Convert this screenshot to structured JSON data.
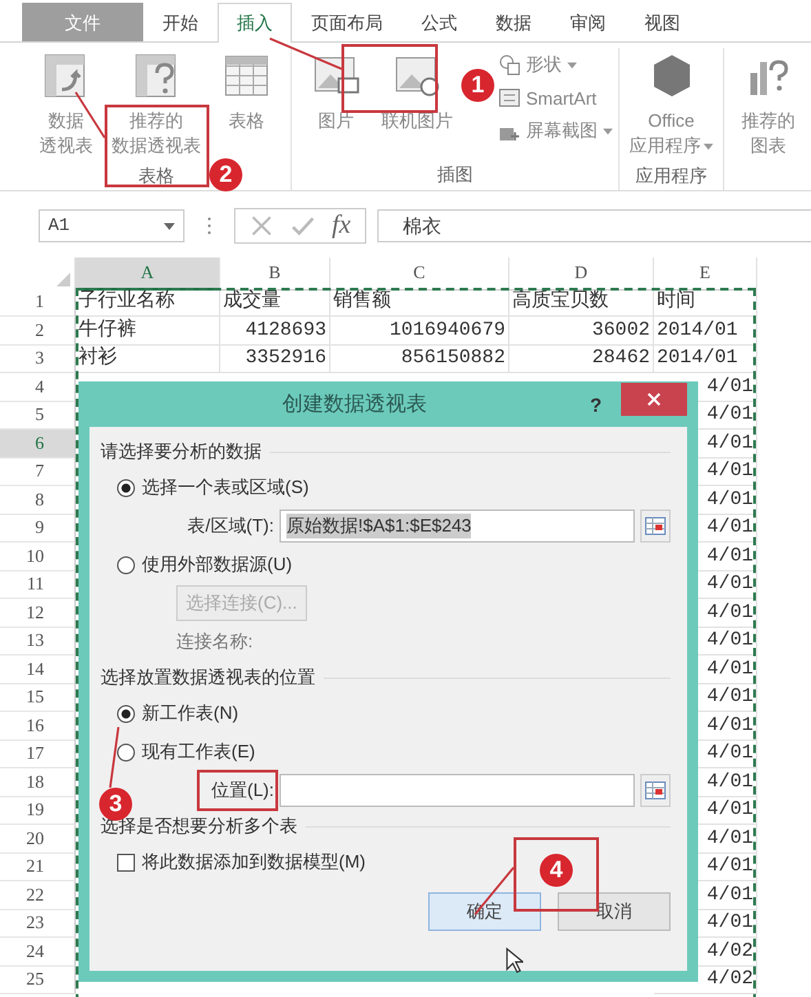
{
  "ribbon": {
    "tabs": [
      {
        "label": "文件",
        "kind": "file",
        "selected": false
      },
      {
        "label": "开始",
        "kind": "tab",
        "selected": false
      },
      {
        "label": "插入",
        "kind": "tab",
        "selected": true
      },
      {
        "label": "页面布局",
        "kind": "tab",
        "selected": false
      },
      {
        "label": "公式",
        "kind": "tab",
        "selected": false
      },
      {
        "label": "数据",
        "kind": "tab",
        "selected": false
      },
      {
        "label": "审阅",
        "kind": "tab",
        "selected": false
      },
      {
        "label": "视图",
        "kind": "tab",
        "selected": false
      }
    ],
    "groups": [
      {
        "label": "表格",
        "items": [
          {
            "kind": "large",
            "lines": [
              "数据",
              "透视表"
            ]
          },
          {
            "kind": "large",
            "lines": [
              "推荐的",
              "数据透视表"
            ]
          },
          {
            "kind": "large",
            "lines": [
              "表格"
            ]
          }
        ]
      },
      {
        "label": "插图",
        "items": [
          {
            "kind": "large",
            "lines": [
              "图片"
            ]
          },
          {
            "kind": "large",
            "lines": [
              "联机图片"
            ]
          },
          {
            "kind": "small",
            "lines": [
              "形状"
            ],
            "dropdown": true
          },
          {
            "kind": "small",
            "lines": [
              "SmartArt"
            ],
            "dropdown": false
          },
          {
            "kind": "small",
            "lines": [
              "屏幕截图"
            ],
            "dropdown": true
          }
        ]
      },
      {
        "label": "应用程序",
        "items": [
          {
            "kind": "large",
            "lines": [
              "Office",
              "应用程序"
            ],
            "dropdown": true
          }
        ]
      },
      {
        "items": [
          {
            "kind": "large",
            "lines": [
              "推荐的",
              "图表"
            ]
          }
        ]
      }
    ]
  },
  "formula_bar": {
    "name_box": "A1",
    "function_label": "fx",
    "formula": "棉衣"
  },
  "sheet": {
    "columns": [
      {
        "label": "A",
        "selected": true
      },
      {
        "label": "B",
        "selected": false
      },
      {
        "label": "C",
        "selected": false
      },
      {
        "label": "D",
        "selected": false
      },
      {
        "label": "E",
        "selected": false
      }
    ],
    "rows": [
      {
        "number": "1",
        "selected": false,
        "cells": [
          "子行业名称",
          "成交量",
          "销售额",
          "高质宝贝数",
          "时间"
        ]
      },
      {
        "number": "2",
        "selected": false,
        "cells": [
          "牛仔裤",
          "4128693",
          "1016940679",
          "36002",
          "2014/01"
        ]
      },
      {
        "number": "3",
        "selected": false,
        "cells": [
          "衬衫",
          "3352916",
          "856150882",
          "28462",
          "2014/01"
        ]
      },
      {
        "number": "4",
        "selected": false,
        "cells": [
          "4/01"
        ]
      },
      {
        "number": "5",
        "selected": false,
        "cells": [
          "4/01"
        ]
      },
      {
        "number": "6",
        "selected": true,
        "cells": [
          "4/01"
        ]
      },
      {
        "number": "7",
        "selected": false,
        "cells": [
          "4/01"
        ]
      },
      {
        "number": "8",
        "selected": false,
        "cells": [
          "4/01"
        ]
      },
      {
        "number": "9",
        "selected": false,
        "cells": [
          "4/01"
        ]
      },
      {
        "number": "10",
        "selected": false,
        "cells": [
          "4/01"
        ]
      },
      {
        "number": "11",
        "selected": false,
        "cells": [
          "4/01"
        ]
      },
      {
        "number": "12",
        "selected": false,
        "cells": [
          "4/01"
        ]
      },
      {
        "number": "13",
        "selected": false,
        "cells": [
          "4/01"
        ]
      },
      {
        "number": "14",
        "selected": false,
        "cells": [
          "4/01"
        ]
      },
      {
        "number": "15",
        "selected": false,
        "cells": [
          "4/01"
        ]
      },
      {
        "number": "16",
        "selected": false,
        "cells": [
          "4/01"
        ]
      },
      {
        "number": "17",
        "selected": false,
        "cells": [
          "4/01"
        ]
      },
      {
        "number": "18",
        "selected": false,
        "cells": [
          "4/01"
        ]
      },
      {
        "number": "19",
        "selected": false,
        "cells": [
          "4/01"
        ]
      },
      {
        "number": "20",
        "selected": false,
        "cells": [
          "4/01"
        ]
      },
      {
        "number": "21",
        "selected": false,
        "cells": [
          "4/01"
        ]
      },
      {
        "number": "22",
        "selected": false,
        "cells": [
          "4/01"
        ]
      },
      {
        "number": "23",
        "selected": false,
        "cells": [
          "4/01"
        ]
      },
      {
        "number": "24",
        "selected": false,
        "cells": [
          "4/02"
        ]
      },
      {
        "number": "25",
        "selected": false,
        "cells": [
          "4/02"
        ]
      }
    ]
  },
  "dialog": {
    "title": "创建数据透视表",
    "help": "?",
    "sections": [
      {
        "heading": "请选择要分析的数据",
        "items": [
          {
            "kind": "radio",
            "label": "选择一个表或区域(S)",
            "selected": true
          },
          {
            "kind": "field",
            "label": "表/区域(T):",
            "value": "原始数据!$A$1:$E$243"
          },
          {
            "kind": "radio",
            "label": "使用外部数据源(U)",
            "selected": false
          },
          {
            "kind": "button",
            "label": "选择连接(C)...",
            "disabled": true
          },
          {
            "kind": "note",
            "label": "连接名称:"
          }
        ]
      },
      {
        "heading": "选择放置数据透视表的位置",
        "items": [
          {
            "kind": "radio",
            "label": "新工作表(N)",
            "selected": true
          },
          {
            "kind": "radio",
            "label": "现有工作表(E)",
            "selected": false
          },
          {
            "kind": "field",
            "label": "位置(L):"
          }
        ]
      },
      {
        "heading": "选择是否想要分析多个表",
        "items": [
          {
            "kind": "checkbox",
            "label": "将此数据添加到数据模型(M)",
            "checked": false
          }
        ]
      }
    ],
    "buttons": [
      {
        "label": "确定",
        "default": true
      },
      {
        "label": "取消",
        "default": false
      }
    ]
  },
  "annotations": [
    {
      "number": "1"
    },
    {
      "number": "2"
    },
    {
      "number": "3"
    },
    {
      "number": "4"
    }
  ]
}
